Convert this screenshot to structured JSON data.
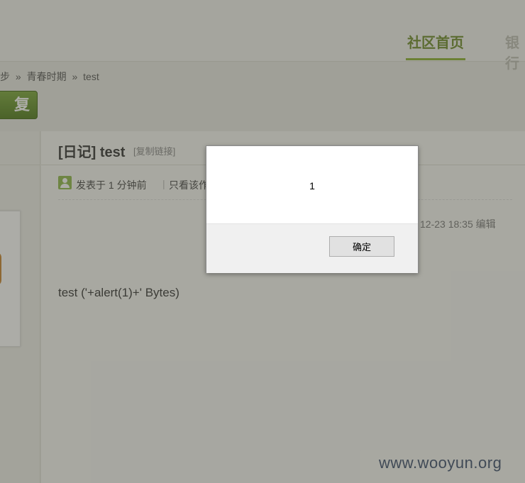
{
  "nav": {
    "active_label": "社区首页",
    "next_label": "银行"
  },
  "breadcrumb": {
    "prefix": "步",
    "sep1": "»",
    "section": "青春时期",
    "sep2": "»",
    "current": "test"
  },
  "reply_button": {
    "label": "复"
  },
  "post": {
    "title": "[日记] test",
    "copy_link": "[复制链接]",
    "posted": "发表于 1 分钟前",
    "separator": "|",
    "only_author": "只看该作者",
    "edit_info": "12-23 18:35 编辑",
    "body": "test ('+alert(1)+' Bytes)"
  },
  "dialog": {
    "message": "1",
    "ok_label": "确定"
  },
  "watermark": "www.wooyun.org"
}
